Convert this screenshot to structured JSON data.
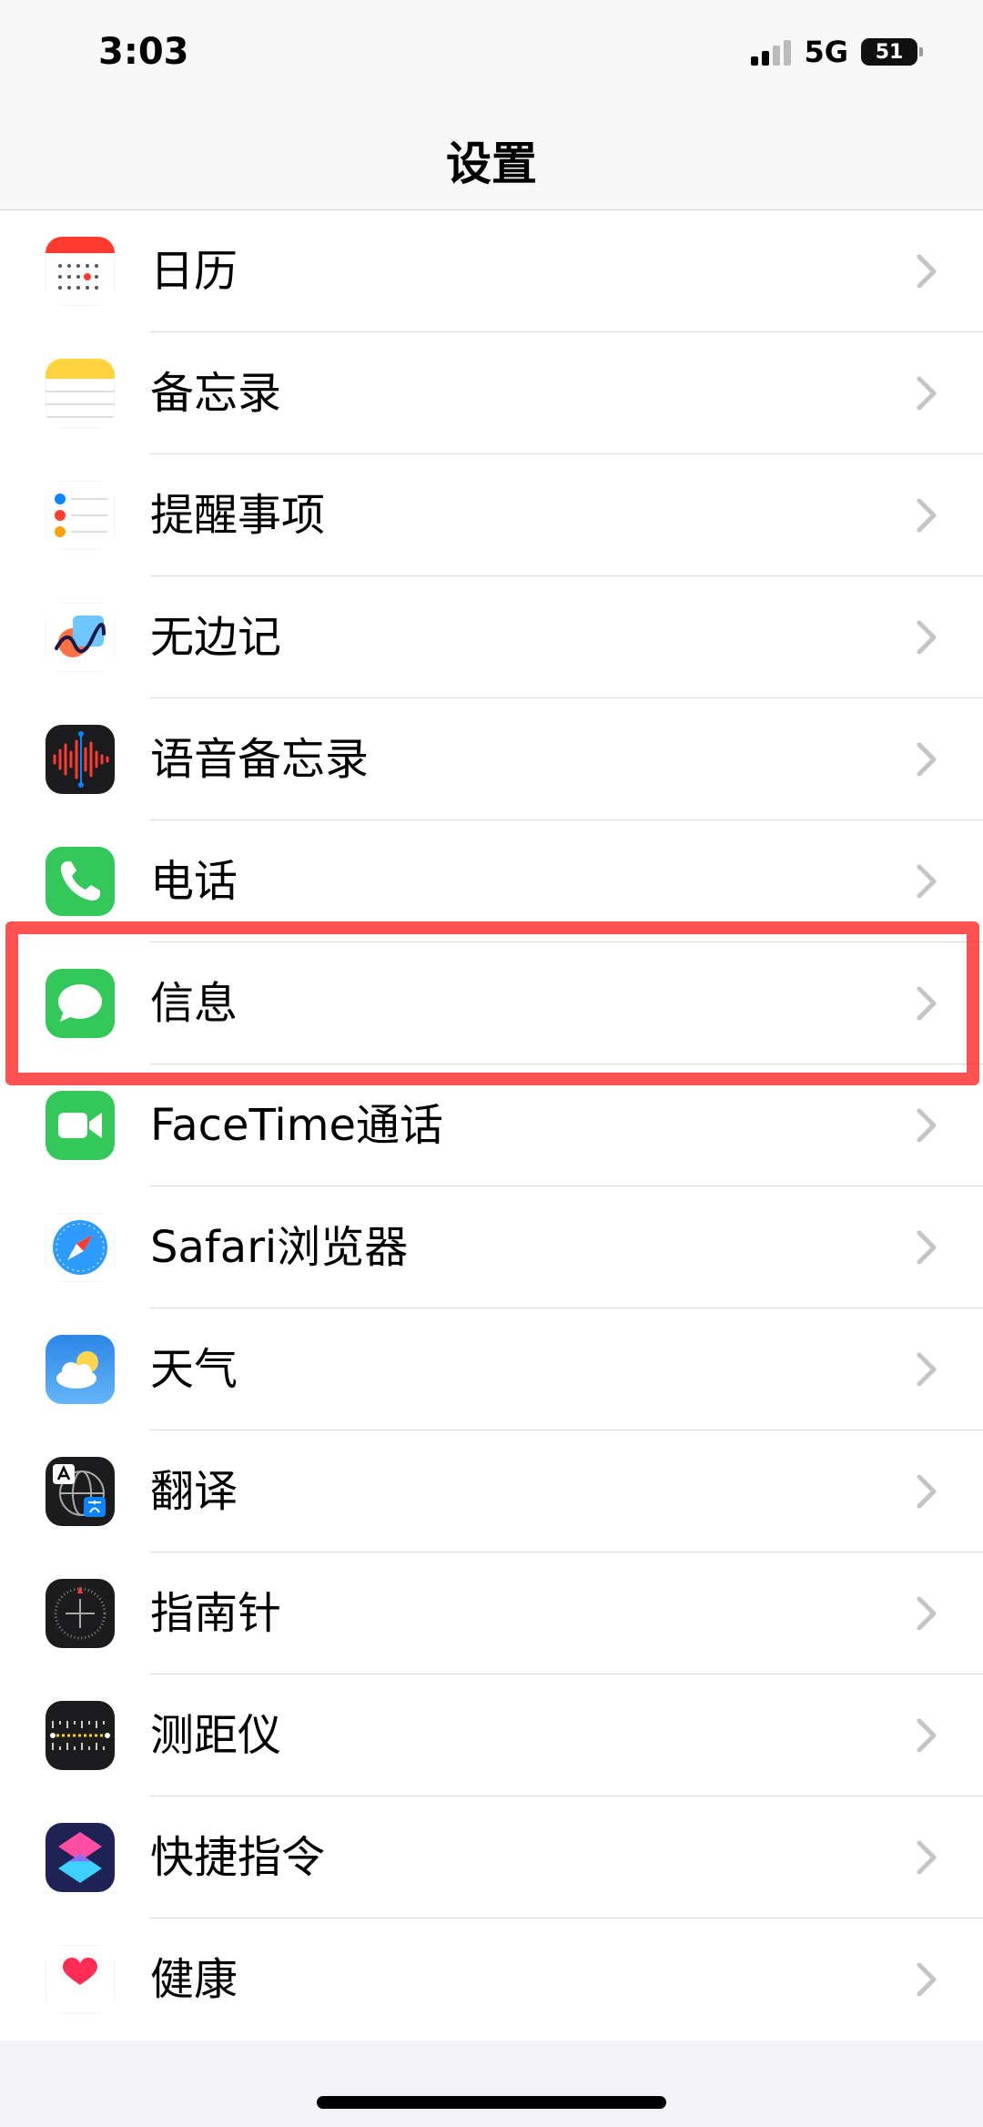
{
  "status": {
    "time": "3:03",
    "network": "5G",
    "battery": "51"
  },
  "nav": {
    "title": "设置"
  },
  "items": [
    {
      "label": "日历",
      "icon": "calendar-icon"
    },
    {
      "label": "备忘录",
      "icon": "notes-icon"
    },
    {
      "label": "提醒事项",
      "icon": "reminders-icon"
    },
    {
      "label": "无边记",
      "icon": "freeform-icon"
    },
    {
      "label": "语音备忘录",
      "icon": "voice-memos-icon"
    },
    {
      "label": "电话",
      "icon": "phone-icon"
    },
    {
      "label": "信息",
      "icon": "messages-icon"
    },
    {
      "label": "FaceTime通话",
      "icon": "facetime-icon"
    },
    {
      "label": "Safari浏览器",
      "icon": "safari-icon"
    },
    {
      "label": "天气",
      "icon": "weather-icon"
    },
    {
      "label": "翻译",
      "icon": "translate-icon"
    },
    {
      "label": "指南针",
      "icon": "compass-icon"
    },
    {
      "label": "测距仪",
      "icon": "measure-icon"
    },
    {
      "label": "快捷指令",
      "icon": "shortcuts-icon"
    },
    {
      "label": "健康",
      "icon": "health-icon"
    }
  ],
  "colors": {
    "highlight": "#ff2828",
    "green": "#34c759",
    "calendar_red": "#ff3b30"
  }
}
